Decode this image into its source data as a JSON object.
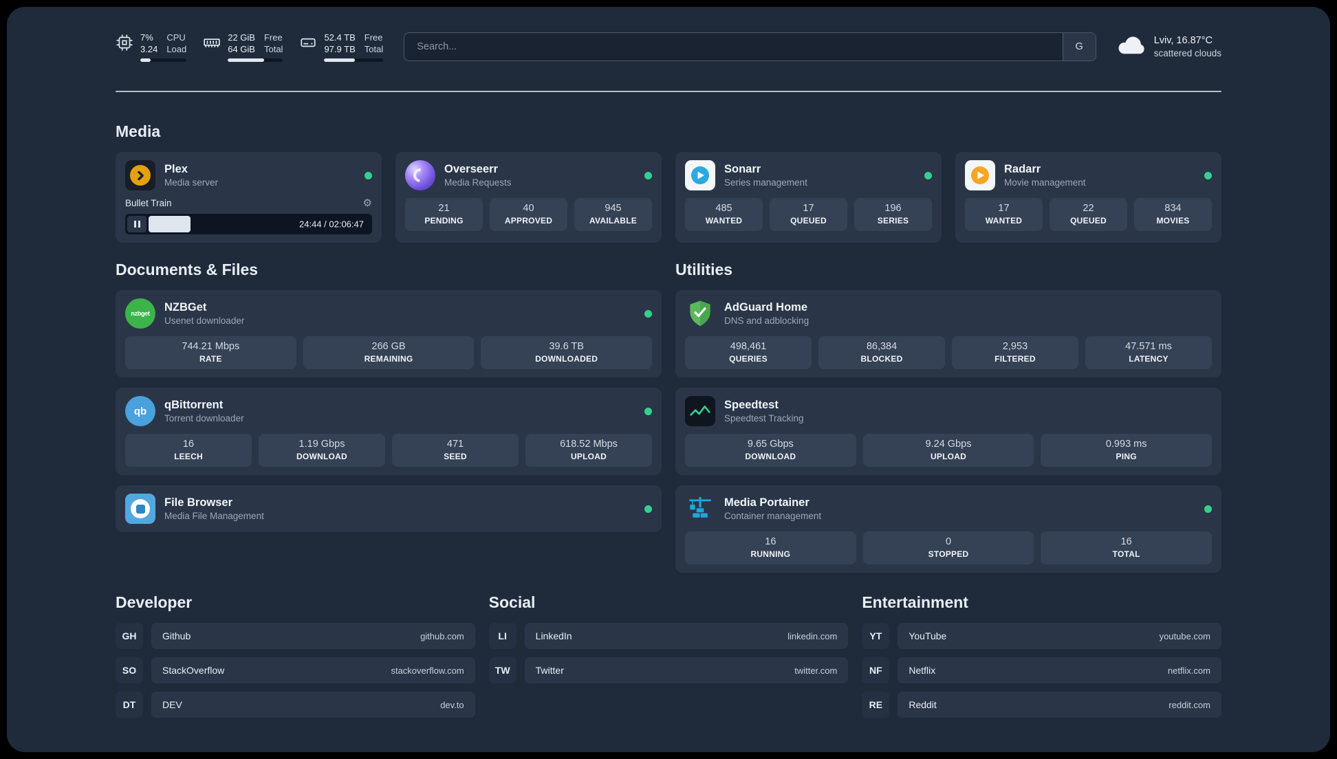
{
  "colors": {
    "background": "#1f2a3b",
    "card": "#2a3648",
    "tile": "#354155",
    "accent_green": "#35d08e",
    "plex_gold": "#e5a00d",
    "sonarr_blue": "#2da8e0",
    "radarr_orange": "#f5a623",
    "nzbget_green": "#3cb44a",
    "portainer_blue": "#1ea7dd"
  },
  "topbar": {
    "cpu": {
      "value_top": "7%",
      "value_bottom": "3.24",
      "label_top": "CPU",
      "label_bottom": "Load",
      "bar_pct": 22
    },
    "ram": {
      "value_top": "22 GiB",
      "value_bottom": "64 GiB",
      "label_top": "Free",
      "label_bottom": "Total",
      "bar_pct": 66
    },
    "disk": {
      "value_top": "52.4 TB",
      "value_bottom": "97.9 TB",
      "label_top": "Free",
      "label_bottom": "Total",
      "bar_pct": 52
    },
    "search": {
      "placeholder": "Search...",
      "button_label": "G"
    },
    "weather": {
      "location": "Lviv, 16.87°C",
      "condition": "scattered clouds"
    }
  },
  "sections": {
    "media": "Media",
    "documents": "Documents & Files",
    "utilities": "Utilities",
    "developer": "Developer",
    "social": "Social",
    "entertainment": "Entertainment"
  },
  "services": {
    "plex": {
      "name": "Plex",
      "subtitle": "Media server",
      "now_playing": "Bullet Train",
      "time": "24:44 / 02:06:47",
      "progress_pct": 19
    },
    "overseerr": {
      "name": "Overseerr",
      "subtitle": "Media Requests",
      "stats": [
        {
          "value": "21",
          "label": "PENDING"
        },
        {
          "value": "40",
          "label": "APPROVED"
        },
        {
          "value": "945",
          "label": "AVAILABLE"
        }
      ]
    },
    "sonarr": {
      "name": "Sonarr",
      "subtitle": "Series management",
      "stats": [
        {
          "value": "485",
          "label": "WANTED"
        },
        {
          "value": "17",
          "label": "QUEUED"
        },
        {
          "value": "196",
          "label": "SERIES"
        }
      ]
    },
    "radarr": {
      "name": "Radarr",
      "subtitle": "Movie management",
      "stats": [
        {
          "value": "17",
          "label": "WANTED"
        },
        {
          "value": "22",
          "label": "QUEUED"
        },
        {
          "value": "834",
          "label": "MOVIES"
        }
      ]
    },
    "nzbget": {
      "name": "NZBGet",
      "subtitle": "Usenet downloader",
      "stats": [
        {
          "value": "744.21 Mbps",
          "label": "RATE"
        },
        {
          "value": "266 GB",
          "label": "REMAINING"
        },
        {
          "value": "39.6 TB",
          "label": "DOWNLOADED"
        }
      ]
    },
    "qbittorrent": {
      "name": "qBittorrent",
      "subtitle": "Torrent downloader",
      "stats": [
        {
          "value": "16",
          "label": "LEECH"
        },
        {
          "value": "1.19 Gbps",
          "label": "DOWNLOAD"
        },
        {
          "value": "471",
          "label": "SEED"
        },
        {
          "value": "618.52 Mbps",
          "label": "UPLOAD"
        }
      ]
    },
    "filebrowser": {
      "name": "File Browser",
      "subtitle": "Media File Management"
    },
    "adguard": {
      "name": "AdGuard Home",
      "subtitle": "DNS and adblocking",
      "stats": [
        {
          "value": "498,461",
          "label": "QUERIES"
        },
        {
          "value": "86,384",
          "label": "BLOCKED"
        },
        {
          "value": "2,953",
          "label": "FILTERED"
        },
        {
          "value": "47.571 ms",
          "label": "LATENCY"
        }
      ]
    },
    "speedtest": {
      "name": "Speedtest",
      "subtitle": "Speedtest Tracking",
      "stats": [
        {
          "value": "9.65 Gbps",
          "label": "DOWNLOAD"
        },
        {
          "value": "9.24 Gbps",
          "label": "UPLOAD"
        },
        {
          "value": "0.993 ms",
          "label": "PING"
        }
      ]
    },
    "portainer": {
      "name": "Media Portainer",
      "subtitle": "Container management",
      "stats": [
        {
          "value": "16",
          "label": "RUNNING"
        },
        {
          "value": "0",
          "label": "STOPPED"
        },
        {
          "value": "16",
          "label": "TOTAL"
        }
      ]
    }
  },
  "bookmarks": {
    "developer": [
      {
        "abbr": "GH",
        "name": "Github",
        "url": "github.com"
      },
      {
        "abbr": "SO",
        "name": "StackOverflow",
        "url": "stackoverflow.com"
      },
      {
        "abbr": "DT",
        "name": "DEV",
        "url": "dev.to"
      }
    ],
    "social": [
      {
        "abbr": "LI",
        "name": "LinkedIn",
        "url": "linkedin.com"
      },
      {
        "abbr": "TW",
        "name": "Twitter",
        "url": "twitter.com"
      }
    ],
    "entertainment": [
      {
        "abbr": "YT",
        "name": "YouTube",
        "url": "youtube.com"
      },
      {
        "abbr": "NF",
        "name": "Netflix",
        "url": "netflix.com"
      },
      {
        "abbr": "RE",
        "name": "Reddit",
        "url": "reddit.com"
      }
    ]
  },
  "icons": {
    "nzbget_text": "nzbget",
    "qbittorrent_text": "qb"
  }
}
